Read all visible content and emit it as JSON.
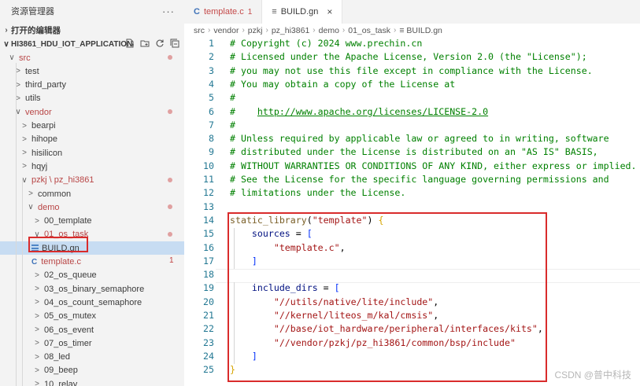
{
  "sidebar": {
    "title": "资源管理器",
    "more_label": "···",
    "open_editors_label": "打开的编辑器",
    "project_label": "HI3861_HDU_IOT_APPLICATION",
    "tree": [
      {
        "label": "src",
        "chev": "∨",
        "red": true,
        "dot": true
      },
      {
        "label": "test",
        "chev": ">",
        "red": false
      },
      {
        "label": "third_party",
        "chev": ">",
        "red": false
      },
      {
        "label": "utils",
        "chev": ">",
        "red": false
      },
      {
        "label": "vendor",
        "chev": "∨",
        "red": true,
        "dot": true
      },
      {
        "label": "bearpi",
        "chev": ">",
        "red": false
      },
      {
        "label": "hihope",
        "chev": ">",
        "red": false
      },
      {
        "label": "hisilicon",
        "chev": ">",
        "red": false
      },
      {
        "label": "hqyj",
        "chev": ">",
        "red": false
      },
      {
        "label": "pzkj \\ pz_hi3861",
        "chev": "∨",
        "red": true,
        "dot": true
      },
      {
        "label": "common",
        "chev": ">",
        "red": false
      },
      {
        "label": "demo",
        "chev": "∨",
        "red": true,
        "dot": true
      },
      {
        "label": "00_template",
        "chev": ">",
        "red": false
      },
      {
        "label": "01_os_task",
        "chev": "∨",
        "red": true,
        "dot": true
      },
      {
        "label": "BUILD.gn",
        "icon": "gn",
        "selected": true
      },
      {
        "label": "template.c",
        "icon": "c",
        "red": true,
        "badge": "1"
      },
      {
        "label": "02_os_queue",
        "chev": ">",
        "red": false
      },
      {
        "label": "03_os_binary_semaphore",
        "chev": ">",
        "red": false
      },
      {
        "label": "04_os_count_semaphore",
        "chev": ">",
        "red": false
      },
      {
        "label": "05_os_mutex",
        "chev": ">",
        "red": false
      },
      {
        "label": "06_os_event",
        "chev": ">",
        "red": false
      },
      {
        "label": "07_os_timer",
        "chev": ">",
        "red": false
      },
      {
        "label": "08_led",
        "chev": ">",
        "red": false
      },
      {
        "label": "09_beep",
        "chev": ">",
        "red": false
      },
      {
        "label": "10_relay",
        "chev": ">",
        "red": false
      }
    ]
  },
  "tabs": [
    {
      "icon": "C",
      "label": "template.c",
      "badge": "1",
      "active": false
    },
    {
      "icon": "≡",
      "label": "BUILD.gn",
      "close": "×",
      "active": true
    }
  ],
  "breadcrumb": [
    "src",
    "vendor",
    "pzkj",
    "pz_hi3861",
    "demo",
    "01_os_task",
    "≡ BUILD.gn"
  ],
  "code_lines": [
    {
      "n": "1",
      "text": "# Copyright (c) 2024 www.prechin.cn"
    },
    {
      "n": "2",
      "text": "# Licensed under the Apache License, Version 2.0 (the \"License\");"
    },
    {
      "n": "3",
      "text": "# you may not use this file except in compliance with the License."
    },
    {
      "n": "4",
      "text": "# You may obtain a copy of the License at"
    },
    {
      "n": "5",
      "text": "#"
    },
    {
      "n": "6",
      "text": "#    http://www.apache.org/licenses/LICENSE-2.0"
    },
    {
      "n": "7",
      "text": "#"
    },
    {
      "n": "8",
      "text": "# Unless required by applicable law or agreed to in writing, software"
    },
    {
      "n": "9",
      "text": "# distributed under the License is distributed on an \"AS IS\" BASIS,"
    },
    {
      "n": "10",
      "text": "# WITHOUT WARRANTIES OR CONDITIONS OF ANY KIND, either express or implied."
    },
    {
      "n": "11",
      "text": "# See the License for the specific language governing permissions and"
    },
    {
      "n": "12",
      "text": "# limitations under the License."
    },
    {
      "n": "13",
      "text": ""
    },
    {
      "n": "14",
      "text": "static_library(\"template\") {"
    },
    {
      "n": "15",
      "text": "    sources = ["
    },
    {
      "n": "16",
      "text": "        \"template.c\","
    },
    {
      "n": "17",
      "text": "    ]"
    },
    {
      "n": "18",
      "text": ""
    },
    {
      "n": "19",
      "text": "    include_dirs = ["
    },
    {
      "n": "20",
      "text": "        \"//utils/native/lite/include\","
    },
    {
      "n": "21",
      "text": "        \"//kernel/liteos_m/kal/cmsis\","
    },
    {
      "n": "22",
      "text": "        \"//base/iot_hardware/peripheral/interfaces/kits\","
    },
    {
      "n": "23",
      "text": "        \"//vendor/pzkj/pz_hi3861/common/bsp/include\""
    },
    {
      "n": "24",
      "text": "    ]"
    },
    {
      "n": "25",
      "text": "}"
    }
  ],
  "watermark": "CSDN @普中科技",
  "colors": {
    "highlight_box": "#d92b2b",
    "selection": "#c7dcf2",
    "comment": "#008000",
    "string": "#a31515"
  }
}
